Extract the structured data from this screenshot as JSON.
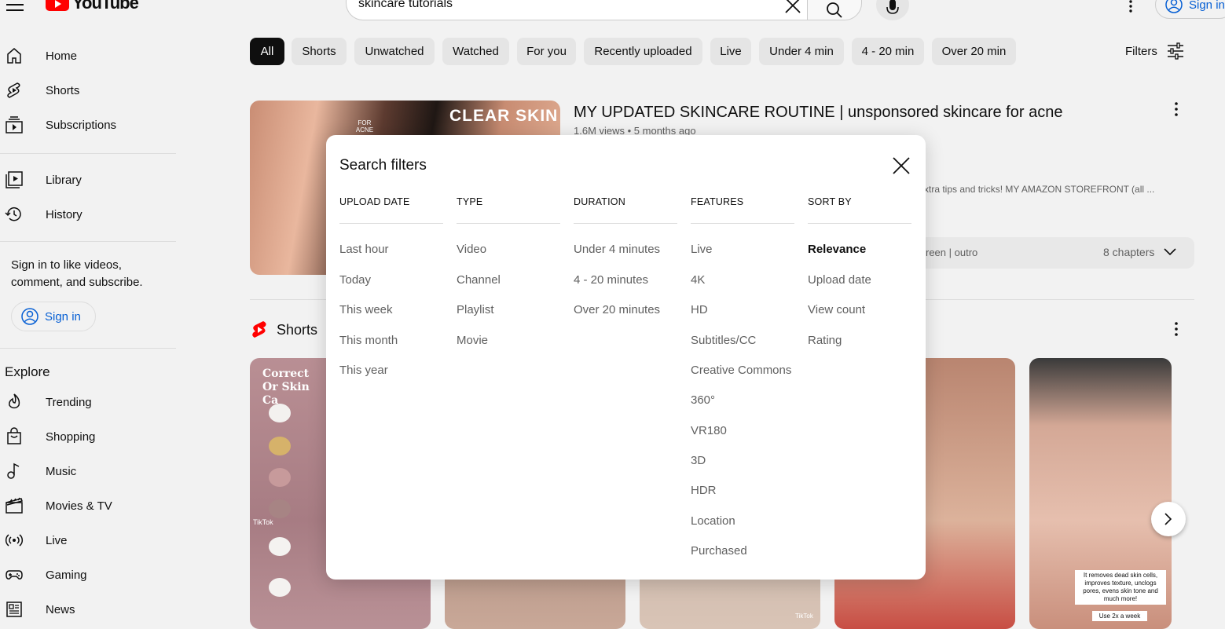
{
  "header": {
    "logo_text": "YouTube",
    "search_value": "skincare tutorials",
    "signin_label": "Sign in"
  },
  "sidebar": {
    "items": [
      {
        "label": "Home",
        "icon": "home-icon"
      },
      {
        "label": "Shorts",
        "icon": "shorts-icon"
      },
      {
        "label": "Subscriptions",
        "icon": "subscriptions-icon"
      },
      {
        "label": "Library",
        "icon": "library-icon"
      },
      {
        "label": "History",
        "icon": "history-icon"
      }
    ],
    "signin_message": "Sign in to like videos, comment, and subscribe.",
    "signin_button": "Sign in",
    "explore_title": "Explore",
    "explore_items": [
      {
        "label": "Trending",
        "icon": "trending-icon"
      },
      {
        "label": "Shopping",
        "icon": "shopping-icon"
      },
      {
        "label": "Music",
        "icon": "music-icon"
      },
      {
        "label": "Movies & TV",
        "icon": "movies-icon"
      },
      {
        "label": "Live",
        "icon": "live-icon"
      },
      {
        "label": "Gaming",
        "icon": "gaming-icon"
      },
      {
        "label": "News",
        "icon": "news-icon"
      }
    ]
  },
  "chips": [
    "All",
    "Shorts",
    "Unwatched",
    "Watched",
    "For you",
    "Recently uploaded",
    "Live",
    "Under 4 min",
    "4 - 20 min",
    "Over 20 min"
  ],
  "filters_label": "Filters",
  "result": {
    "thumb_title": "CLEAR SKIN",
    "thumb_badge": "FOR ACNE",
    "title": "MY UPDATED SKINCARE ROUTINE | unsponsored skincare for acne",
    "meta": "1.6M views • 5 months ago",
    "snippet": "xtra tips and tricks! MY AMAZON STOREFRONT (all ...",
    "chapter_text": "reen | outro",
    "chapters": "8 chapters"
  },
  "shorts": {
    "title": "Shorts",
    "s1_title": "Correct Or Skin Ca",
    "tiktok_label": "TikTok",
    "caption": "It removes dead skin cells, improves texture, unclogs pores, evens skin tone and much more!",
    "caption2": "Use 2x a week"
  },
  "modal": {
    "title": "Search filters",
    "columns": [
      {
        "head": "UPLOAD DATE",
        "options": [
          "Last hour",
          "Today",
          "This week",
          "This month",
          "This year"
        ]
      },
      {
        "head": "TYPE",
        "options": [
          "Video",
          "Channel",
          "Playlist",
          "Movie"
        ]
      },
      {
        "head": "DURATION",
        "options": [
          "Under 4 minutes",
          "4 - 20 minutes",
          "Over 20 minutes"
        ]
      },
      {
        "head": "FEATURES",
        "options": [
          "Live",
          "4K",
          "HD",
          "Subtitles/CC",
          "Creative Commons",
          "360°",
          "VR180",
          "3D",
          "HDR",
          "Location",
          "Purchased"
        ]
      },
      {
        "head": "SORT BY",
        "options": [
          "Relevance",
          "Upload date",
          "View count",
          "Rating"
        ]
      }
    ],
    "selected_sort": "Relevance"
  },
  "colors": {
    "brand_red": "#ff0000",
    "link_blue": "#065fd4",
    "text_secondary": "#606060"
  }
}
